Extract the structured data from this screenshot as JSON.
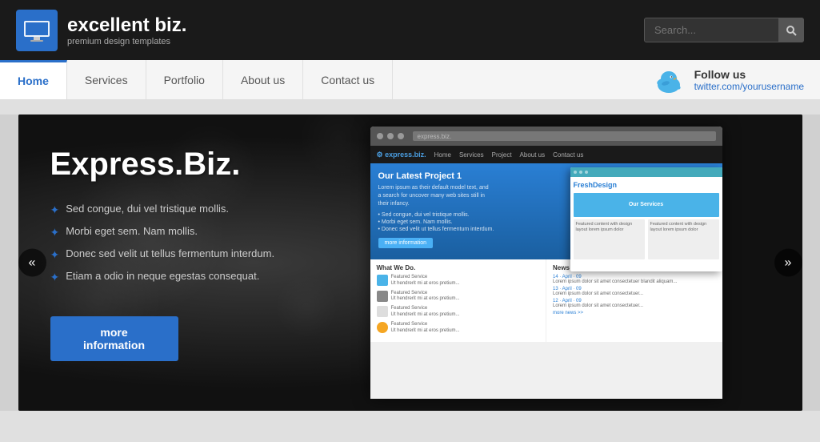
{
  "header": {
    "logo_title": "excellent biz.",
    "logo_subtitle": "premium design templates",
    "search_placeholder": "Search..."
  },
  "nav": {
    "items": [
      {
        "label": "Home",
        "active": true
      },
      {
        "label": "Services",
        "active": false
      },
      {
        "label": "Portfolio",
        "active": false
      },
      {
        "label": "About us",
        "active": false
      },
      {
        "label": "Contact us",
        "active": false
      }
    ],
    "follow_label": "Follow us",
    "follow_username": "twitter.com/yourusername"
  },
  "hero": {
    "title": "Express.Biz.",
    "bullets": [
      "Sed congue, dui vel tristique mollis.",
      "Morbi eget sem. Nam mollis.",
      "Donec sed velit ut tellus fermentum interdum.",
      "Etiam a odio in neque egestas consequat."
    ],
    "cta_label": "more information"
  },
  "inner_site": {
    "logo": "express.biz.",
    "nav_items": [
      "Home",
      "Services",
      "Project",
      "About us",
      "Contact us"
    ],
    "hero_title": "Our Latest Project 1",
    "hero_text": "Lorem ipsum as their default model text, and a search for uncover many web sites still in their infancy.",
    "hero_bullets": [
      "Sed congue, dui vel tristique mollis.",
      "Morbi eget sem. Nam mollis.",
      "Donec sed velit ut tellus fermentum interdum."
    ],
    "hero_btn": "more information",
    "what_we_do": "What We Do.",
    "news_site": "News Site.",
    "nested_title": "FreshDesign"
  },
  "arrows": {
    "prev": "«",
    "next": "»"
  }
}
